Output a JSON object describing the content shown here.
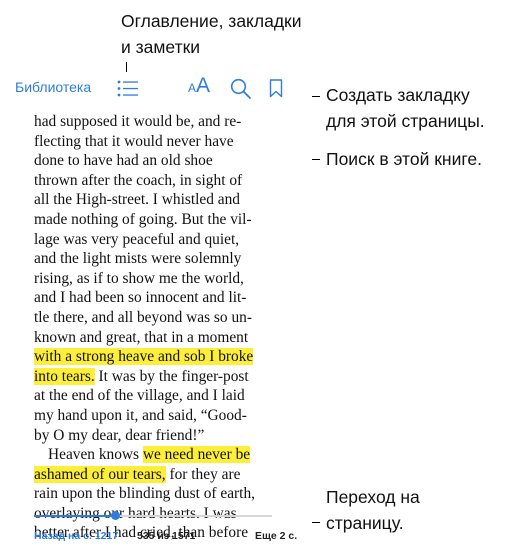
{
  "callouts": {
    "toc_line1": "Оглавление, закладки",
    "toc_line2": "и заметки",
    "bookmark_line1": "Создать закладку",
    "bookmark_line2": "для этой страницы.",
    "search": "Поиск в этой книге.",
    "goto_line1": "Переход на",
    "goto_line2": "страницу."
  },
  "toolbar": {
    "library_label": "Библиотека",
    "font_small": "A",
    "font_big": "A",
    "icons": [
      "list-icon",
      "font-size-icon",
      "search-icon",
      "bookmark-icon"
    ],
    "accent_color": "#2f7ce0"
  },
  "book": {
    "lines_a": [
      "had supposed it would be, and re-",
      "flecting that it would never have",
      "done to have had an old shoe",
      "thrown after the coach, in sight of",
      "all the High-street. I whistled and",
      "made nothing of going. But the vil-",
      "lage was very peaceful and quiet,",
      "and the light mists were solemnly",
      "rising, as if to show me the world,",
      "and I had been so innocent and lit-",
      "tle there, and all beyond was so un-",
      "known and great, that in a moment"
    ],
    "hl1_line1": "with a strong heave and sob I broke",
    "hl1_line2": "into tears.",
    "after_hl1": " It was by the finger-post",
    "lines_b": [
      "at the end of the village, and I laid",
      "my hand upon it, and said, “Good-",
      "by O my dear, dear friend!”"
    ],
    "p2_start": "Heaven knows ",
    "hl2_part1": "we need never be",
    "hl2_part2": "ashamed of our tears,",
    "after_hl2": " for they are",
    "lines_c": [
      "rain upon the blinding dust of earth,",
      "overlaying our hard hearts. I was",
      "better after I had cried, than before"
    ],
    "highlight_color": "#fdee3a"
  },
  "navigation": {
    "progress_fraction": 0.34,
    "back_label": "Назад на с. 1217",
    "page_counter": "535 из 1571",
    "remaining": "Еще 2 с."
  }
}
